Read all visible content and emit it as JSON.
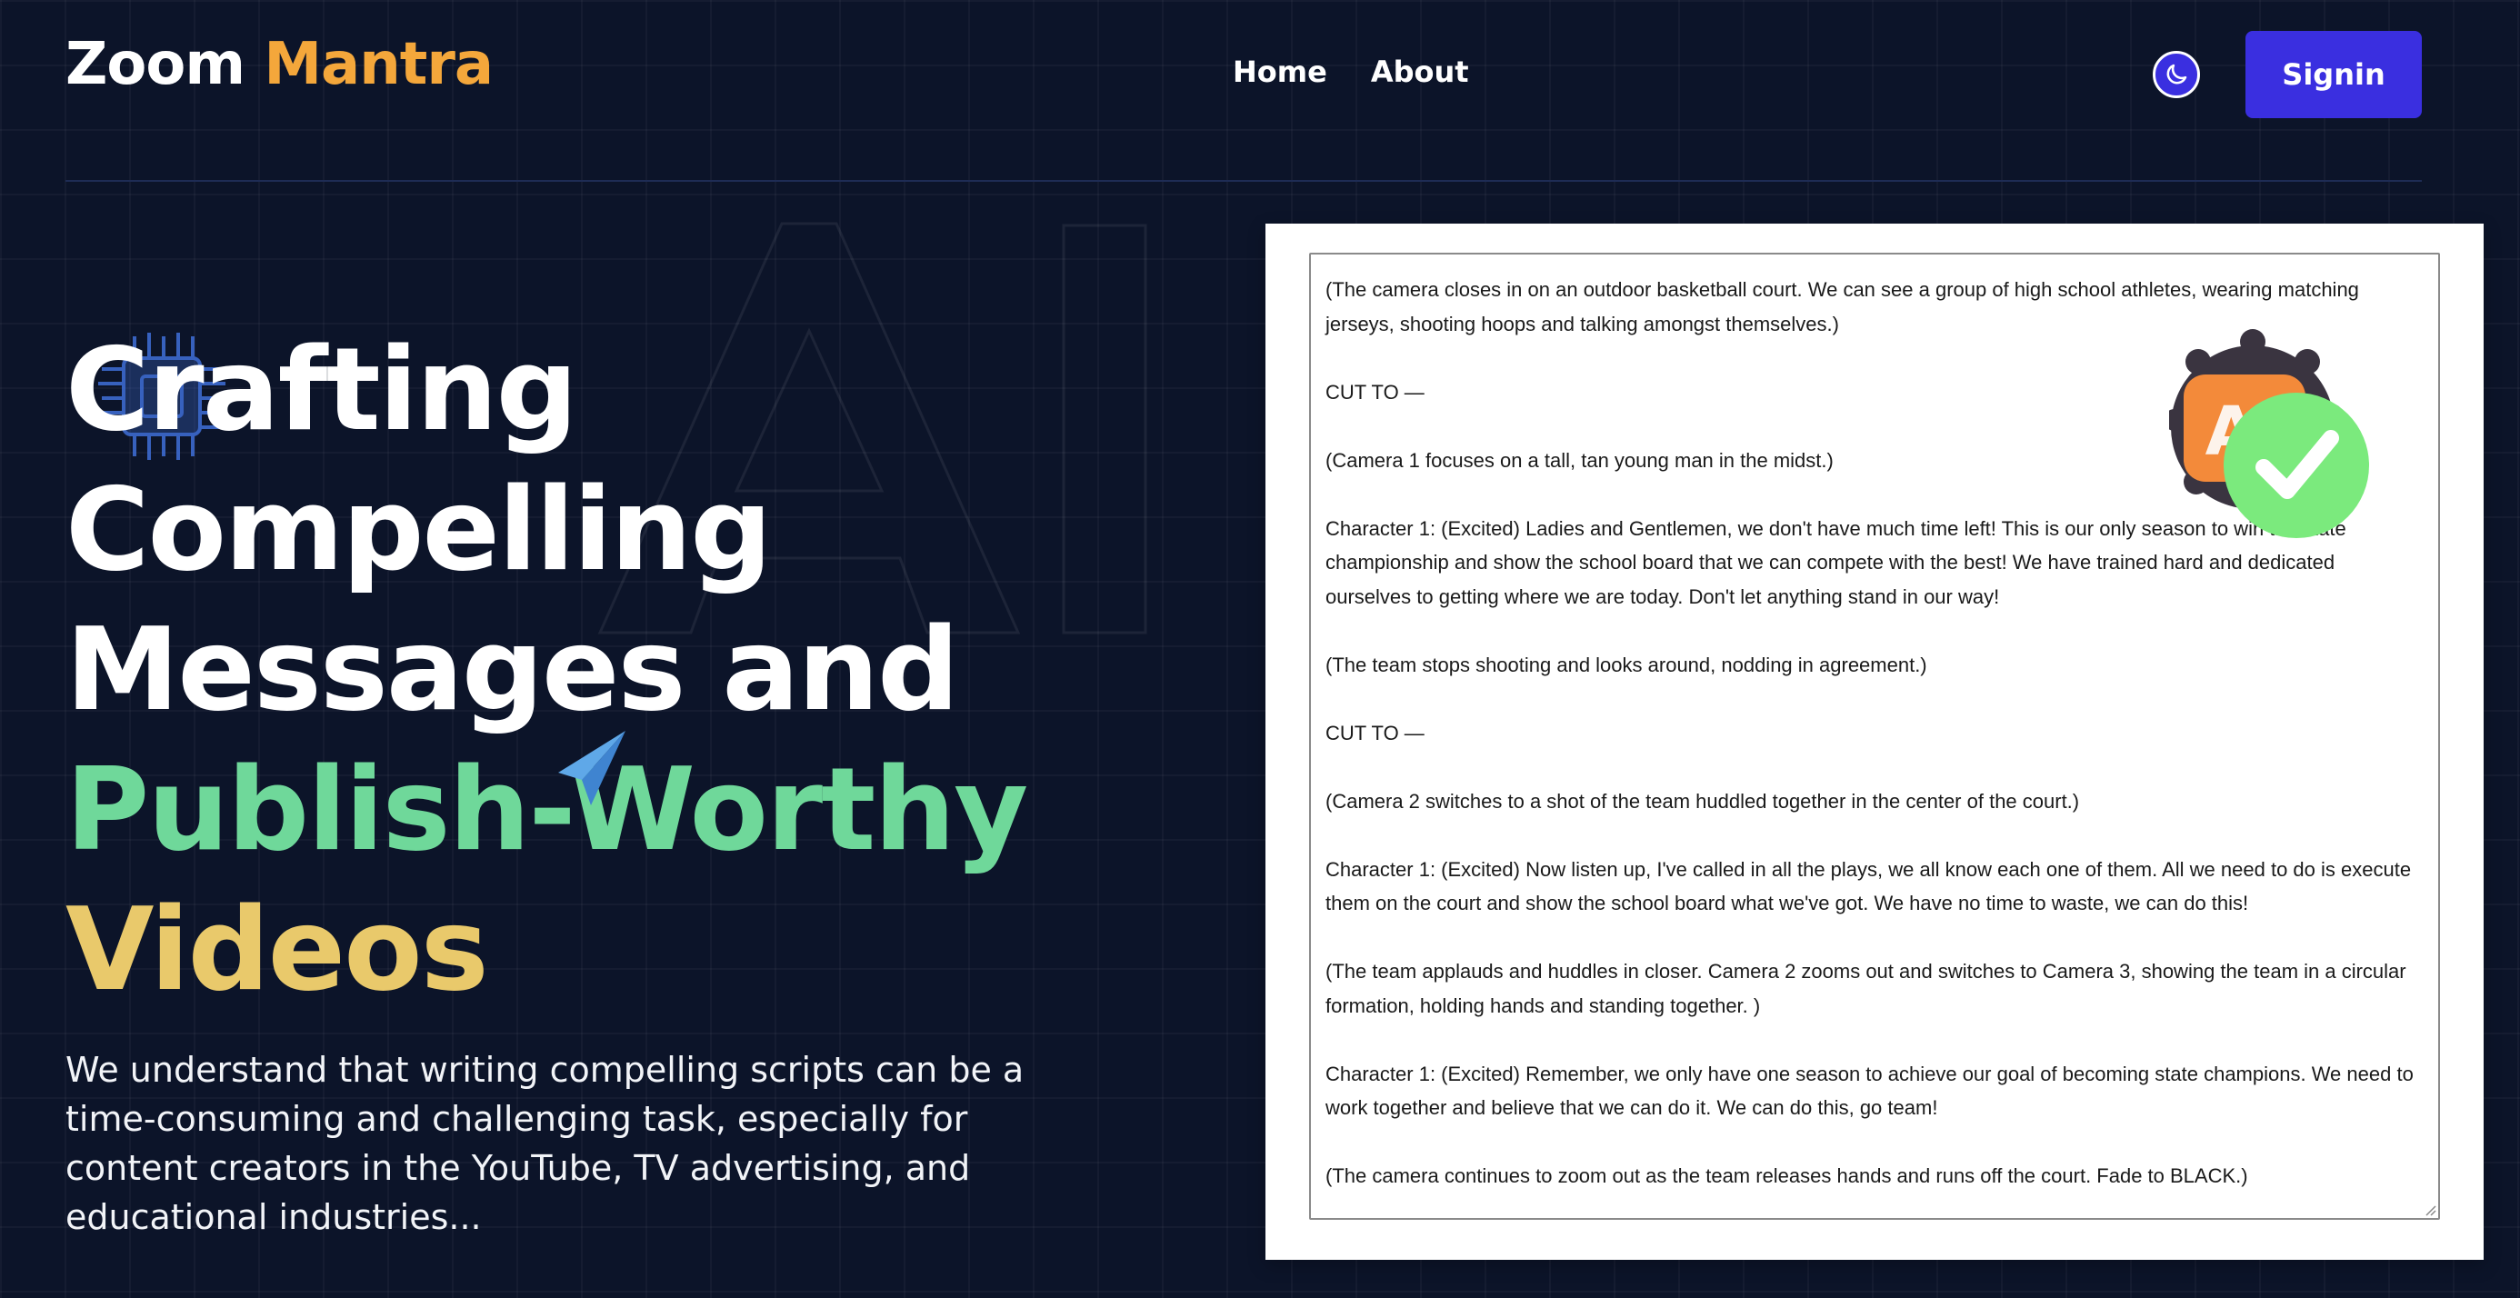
{
  "header": {
    "logo_main": "Zoom",
    "logo_accent": "Mantra",
    "nav": [
      "Home",
      "About"
    ],
    "theme_icon": "moon-icon",
    "signin_label": "Signin"
  },
  "hero": {
    "line1": "Crafting",
    "line2": "Compelling",
    "line3": "Messages and",
    "line4": "Publish-Worthy",
    "line5": "Videos",
    "description": "We understand that writing compelling scripts can be a time-consuming and challenging task, especially for content creators in the YouTube, TV advertising, and educational industries..."
  },
  "decor": {
    "background_letters": "AI",
    "icons": [
      "chip-icon",
      "paper-plane-icon",
      "ai-check-sticker-icon"
    ]
  },
  "script": [
    "(The camera closes in on an outdoor basketball court. We can see a group of high school athletes, wearing matching jerseys, shooting hoops and talking amongst themselves.)",
    "CUT TO —",
    "(Camera 1 focuses on a tall, tan young man in the midst.)",
    "Character 1: (Excited)  Ladies and Gentlemen, we don't have much time left! This is our only season to win the state championship and show the school board that we can compete with the best! We have trained hard and dedicated ourselves to getting where we are today. Don't let anything stand in our way!",
    "(The team stops shooting and looks around, nodding in agreement.)",
    "CUT TO —",
    "(Camera 2 switches to a shot of the team huddled together in the center of the court.)",
    "Character 1: (Excited) Now listen up, I've called in all the plays, we all know each one of them. All we need to do is execute them on the court and show the school board what we've got. We have no time to waste, we can do this!",
    "(The team applauds and huddles in closer. Camera 2 zooms out and switches to Camera 3, showing the team in a circular formation, holding hands and standing together. )",
    "Character 1: (Excited) Remember, we only have one season to achieve our goal of becoming state champions. We need to work together and believe that we can do it. We can do this, go team!",
    "(The camera continues to zoom out as the team releases hands and runs off the court. Fade to BLACK.)"
  ],
  "colors": {
    "background": "#0c1429",
    "brand_accent": "#f4a73b",
    "primary_button": "#3a2fe0",
    "hero_green": "#6fd89a",
    "hero_yellow": "#e9c96b"
  }
}
